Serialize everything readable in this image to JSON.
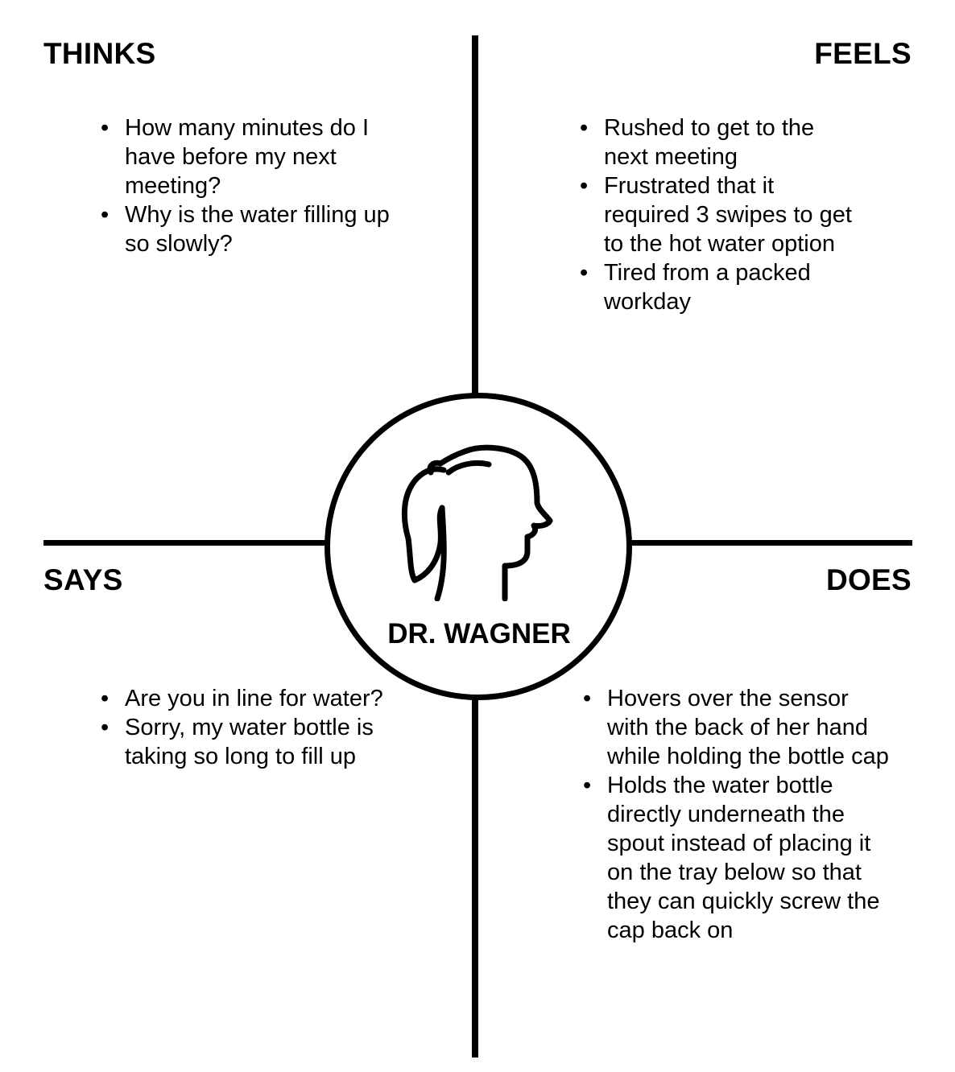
{
  "persona": {
    "name": "DR. WAGNER",
    "icon": "woman-profile-ponytail-icon"
  },
  "quadrants": {
    "thinks": {
      "title": "THINKS",
      "items": [
        "How many minutes do I have before my next meeting?",
        "Why is the water filling up so slowly?"
      ]
    },
    "feels": {
      "title": "FEELS",
      "items": [
        "Rushed to get to the next meeting",
        "Frustrated that it required 3 swipes to get to the hot water option",
        "Tired from a packed workday"
      ]
    },
    "says": {
      "title": "SAYS",
      "items": [
        "Are you in line for water?",
        "Sorry, my water bottle is taking so long to fill up"
      ]
    },
    "does": {
      "title": "DOES",
      "items": [
        "Hovers over the sensor with the back of her hand while holding the bottle cap",
        "Holds the water bottle directly underneath the spout instead of placing it on the tray below so that they can quickly screw the cap back on"
      ]
    }
  }
}
